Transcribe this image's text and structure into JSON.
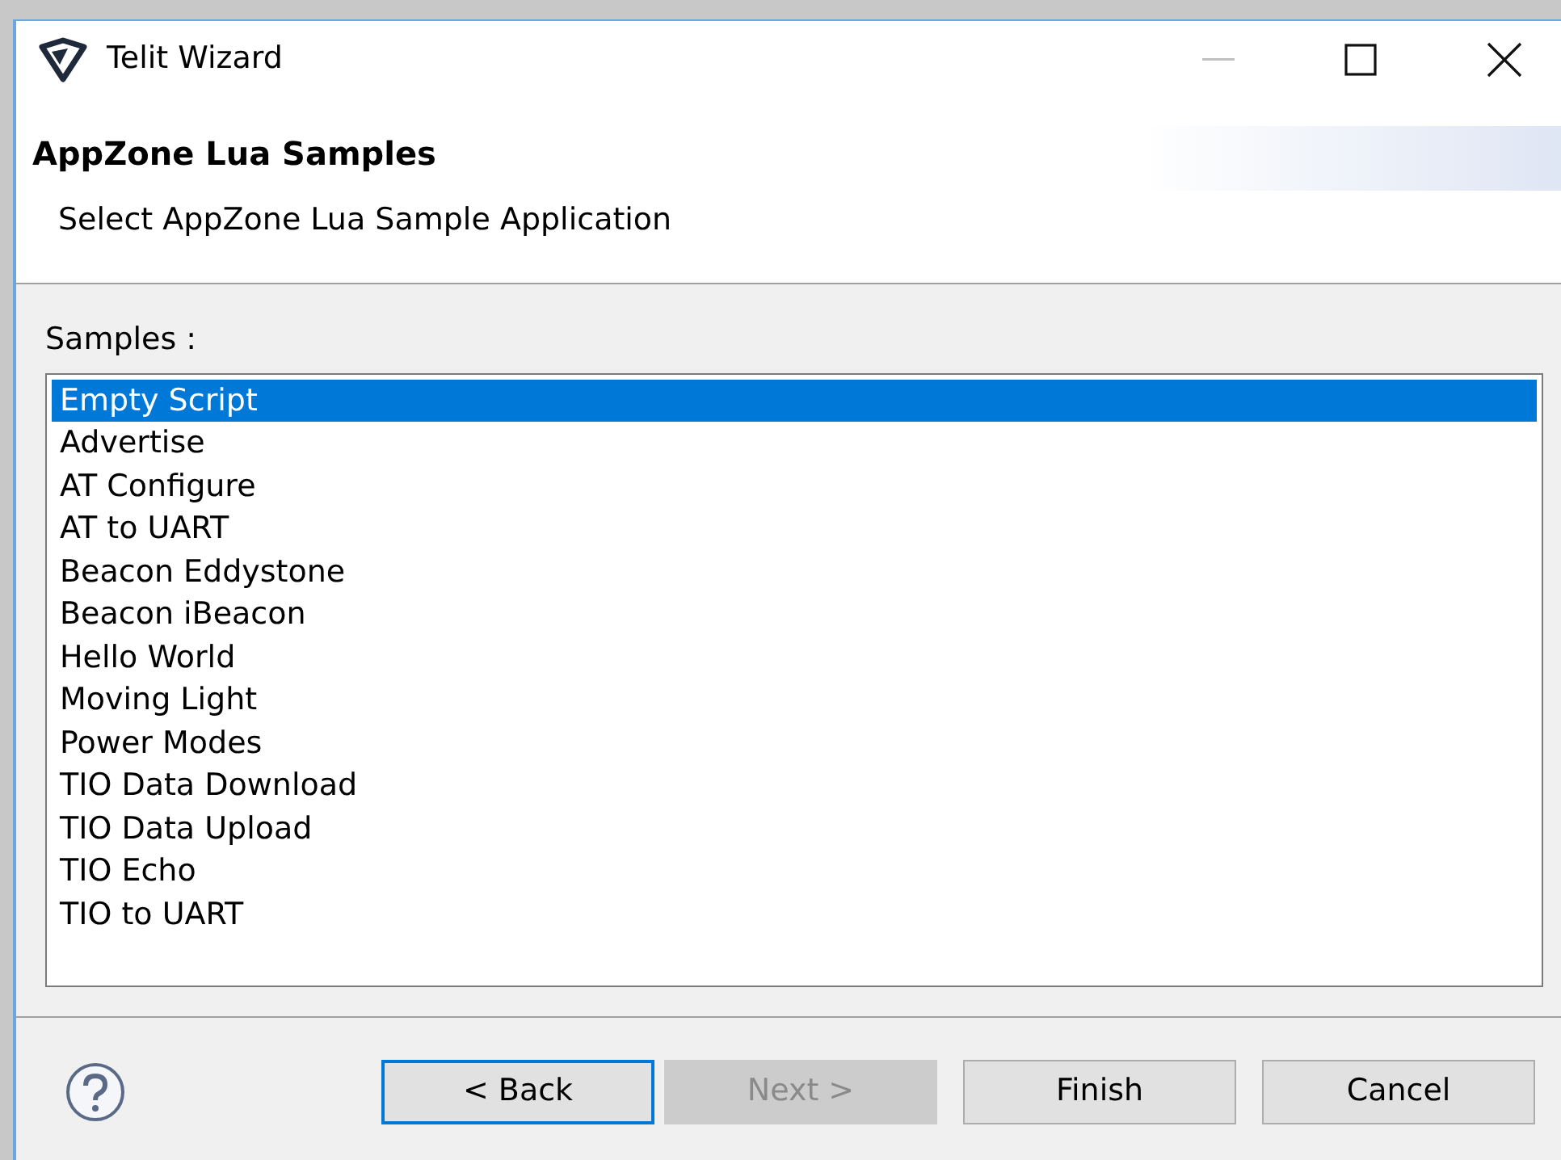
{
  "window": {
    "title": "Telit Wizard"
  },
  "header": {
    "title": "AppZone Lua Samples",
    "description": "Select AppZone Lua Sample Application"
  },
  "samples": {
    "label": "Samples :",
    "items": [
      {
        "label": "Empty Script",
        "selected": true
      },
      {
        "label": "Advertise",
        "selected": false
      },
      {
        "label": "AT Configure",
        "selected": false
      },
      {
        "label": "AT to UART",
        "selected": false
      },
      {
        "label": "Beacon Eddystone",
        "selected": false
      },
      {
        "label": "Beacon iBeacon",
        "selected": false
      },
      {
        "label": "Hello World",
        "selected": false
      },
      {
        "label": "Moving Light",
        "selected": false
      },
      {
        "label": "Power Modes",
        "selected": false
      },
      {
        "label": "TIO Data Download",
        "selected": false
      },
      {
        "label": "TIO Data Upload",
        "selected": false
      },
      {
        "label": "TIO Echo",
        "selected": false
      },
      {
        "label": "TIO to UART",
        "selected": false
      }
    ]
  },
  "buttons": [
    {
      "label": "< Back",
      "focused": true,
      "disabled": false
    },
    {
      "label": "Next >",
      "focused": false,
      "disabled": true
    },
    {
      "label": "Finish",
      "focused": false,
      "disabled": false
    },
    {
      "label": "Cancel",
      "focused": false,
      "disabled": false
    }
  ]
}
